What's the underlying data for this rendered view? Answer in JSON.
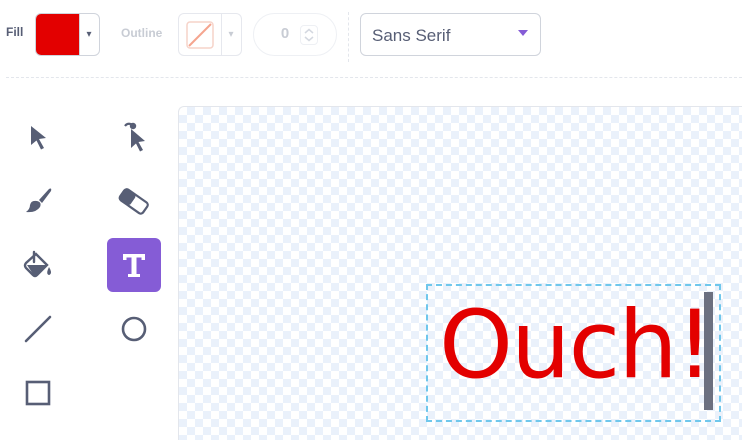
{
  "toolbar": {
    "fill_label": "Fill",
    "fill_color": "#e30000",
    "outline_label": "Outline",
    "outline_color": "none",
    "outline_width": "0",
    "dropdown_glyph": "▾",
    "font_name": "Sans Serif"
  },
  "tools": [
    {
      "name": "select",
      "icon": "arrow-cursor-icon",
      "active": false
    },
    {
      "name": "reshape",
      "icon": "reshape-cursor-icon",
      "active": false
    },
    {
      "name": "brush",
      "icon": "brush-icon",
      "active": false
    },
    {
      "name": "eraser",
      "icon": "eraser-icon",
      "active": false
    },
    {
      "name": "fill",
      "icon": "paint-bucket-icon",
      "active": false
    },
    {
      "name": "text",
      "icon": "text-t-icon",
      "active": true
    },
    {
      "name": "line",
      "icon": "line-icon",
      "active": false
    },
    {
      "name": "circle",
      "icon": "circle-icon",
      "active": false
    },
    {
      "name": "rectangle",
      "icon": "rectangle-icon",
      "active": false
    }
  ],
  "canvas": {
    "text": "Ouch!",
    "text_color": "#e30000",
    "selection_color": "#6fc7ec"
  },
  "colors": {
    "accent": "#855cd6",
    "icon": "#575e75"
  }
}
